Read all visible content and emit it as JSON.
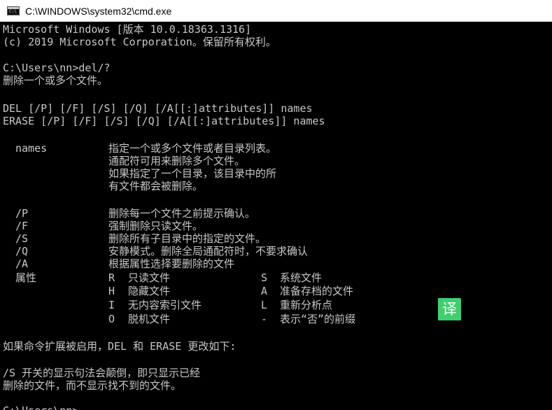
{
  "window": {
    "title": "C:\\WINDOWS\\system32\\cmd.exe",
    "icon": "console-icon"
  },
  "console": {
    "lines": [
      "Microsoft Windows [版本 10.0.18363.1316]",
      "(c) 2019 Microsoft Corporation。保留所有权利。",
      "C:\\Users\\nn>del/?",
      "删除一个或多个文件。",
      "DEL [/P] [/F] [/S] [/Q] [/A[[:]attributes]] names",
      "ERASE [/P] [/F] [/S] [/Q] [/A[[:]attributes]] names"
    ],
    "names_label": "names",
    "names_desc": [
      "指定一个或多个文件或者目录列表。",
      "通配符可用来删除多个文件。",
      "如果指定了一个目录，该目录中的所",
      "有文件都会被删除。"
    ],
    "switches": [
      {
        "flag": "/P",
        "desc": "删除每一个文件之前提示确认。"
      },
      {
        "flag": "/F",
        "desc": "强制删除只读文件。"
      },
      {
        "flag": "/S",
        "desc": "删除所有子目录中的指定的文件。"
      },
      {
        "flag": "/Q",
        "desc": "安静模式。删除全局通配符时，不要求确认"
      },
      {
        "flag": "/A",
        "desc": "根据属性选择要删除的文件"
      }
    ],
    "attributes_label": "属性",
    "attributes": [
      {
        "code1": "R",
        "desc1": "只读文件",
        "code2": "S",
        "desc2": "系统文件"
      },
      {
        "code1": "H",
        "desc1": "隐藏文件",
        "code2": "A",
        "desc2": "准备存档的文件"
      },
      {
        "code1": "I",
        "desc1": "无内容索引文件",
        "code2": "L",
        "desc2": "重新分析点"
      },
      {
        "code1": "O",
        "desc1": "脱机文件",
        "code2": "-",
        "desc2": "表示“否”的前缀"
      }
    ],
    "extension_note": "如果命令扩展被启用，DEL 和 ERASE 更改如下:",
    "s_note": [
      "/S 开关的显示句法会颠倒，即只显示已经",
      "删除的文件，而不显示找不到的文件。"
    ],
    "prompt_partial": "C:\\Users\\nn>"
  },
  "overlay": {
    "translate_label": "译",
    "translate_color": "#3fcf6f"
  },
  "colors": {
    "console_bg": "#000000",
    "console_text": "#c8c8c8",
    "titlebar_bg": "#ffffff"
  }
}
